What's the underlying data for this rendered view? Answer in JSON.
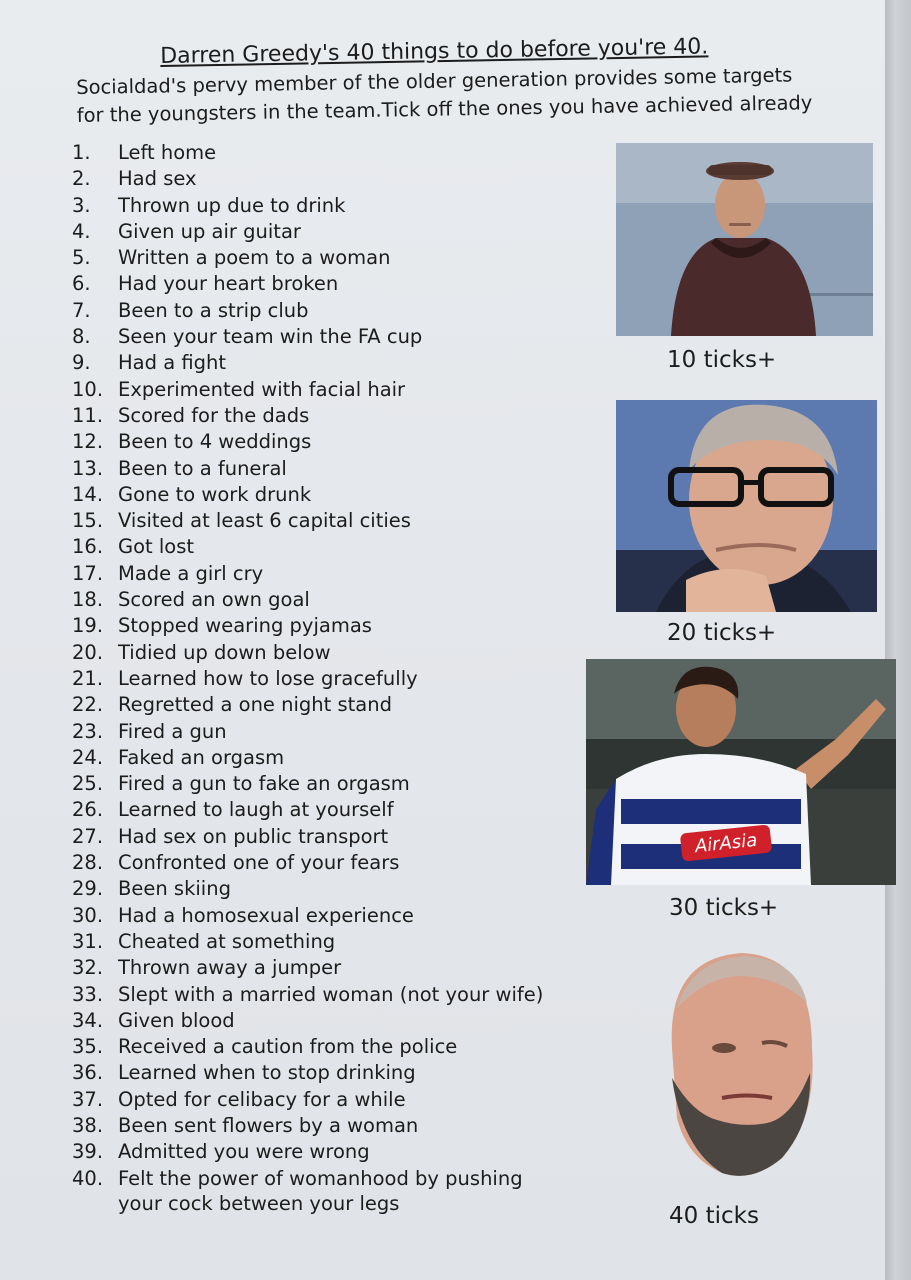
{
  "title": "Darren Greedy's 40 things to do before you're 40.",
  "intro": {
    "line1": "Socialdad's pervy member of the older generation provides some targets",
    "line2": "for the youngsters in the team.Tick off the ones you have achieved already"
  },
  "items": [
    {
      "num": "1.",
      "text": "Left home"
    },
    {
      "num": "2.",
      "text": "Had sex"
    },
    {
      "num": "3.",
      "text": "Thrown up due to drink"
    },
    {
      "num": "4.",
      "text": "Given up air guitar"
    },
    {
      "num": "5.",
      "text": "Written a poem to a woman"
    },
    {
      "num": "6.",
      "text": "Had your heart broken"
    },
    {
      "num": "7.",
      "text": "Been to a strip club"
    },
    {
      "num": "8.",
      "text": "Seen your team win the FA cup"
    },
    {
      "num": "9.",
      "text": "Had a fight"
    },
    {
      "num": "10.",
      "text": "Experimented with facial hair"
    },
    {
      "num": "11.",
      "text": "Scored for the dads"
    },
    {
      "num": "12.",
      "text": "Been to 4 weddings"
    },
    {
      "num": "13.",
      "text": "Been to a funeral"
    },
    {
      "num": "14.",
      "text": "Gone to work drunk"
    },
    {
      "num": "15.",
      "text": "Visited at least 6 capital cities"
    },
    {
      "num": "16.",
      "text": "Got lost"
    },
    {
      "num": "17.",
      "text": "Made a girl cry"
    },
    {
      "num": "18.",
      "text": "Scored an own goal"
    },
    {
      "num": "19.",
      "text": "Stopped wearing pyjamas"
    },
    {
      "num": "20.",
      "text": "Tidied up down below"
    },
    {
      "num": "21.",
      "text": "Learned how to lose gracefully"
    },
    {
      "num": "22.",
      "text": "Regretted a one night stand"
    },
    {
      "num": "23.",
      "text": "Fired a gun"
    },
    {
      "num": "24.",
      "text": "Faked an orgasm"
    },
    {
      "num": "25.",
      "text": "Fired a gun to fake an orgasm"
    },
    {
      "num": "26.",
      "text": "Learned to laugh at yourself"
    },
    {
      "num": "27.",
      "text": "Had sex on public transport"
    },
    {
      "num": "28.",
      "text": "Confronted one of your fears"
    },
    {
      "num": "29.",
      "text": "Been skiing"
    },
    {
      "num": "30.",
      "text": "Had a homosexual experience"
    },
    {
      "num": "31.",
      "text": "Cheated at something"
    },
    {
      "num": "32.",
      "text": "Thrown away a jumper"
    },
    {
      "num": "33.",
      "text": "Slept with a married woman (not your wife)"
    },
    {
      "num": "34.",
      "text": "Given blood"
    },
    {
      "num": "35.",
      "text": "Received a caution from the police"
    },
    {
      "num": "36.",
      "text": "Learned when to stop drinking"
    },
    {
      "num": "37.",
      "text": "Opted for celibacy for a while"
    },
    {
      "num": "38.",
      "text": "Been sent flowers by a woman"
    },
    {
      "num": "39.",
      "text": "Admitted you were wrong"
    },
    {
      "num": "40.",
      "text": "Felt the power of womanhood by pushing your cock between your legs"
    }
  ],
  "photos": [
    {
      "caption": "10 ticks+"
    },
    {
      "caption": "20 ticks+"
    },
    {
      "caption": "30 ticks+",
      "shirt_text": "AirAsia"
    },
    {
      "caption": "40 ticks"
    }
  ]
}
